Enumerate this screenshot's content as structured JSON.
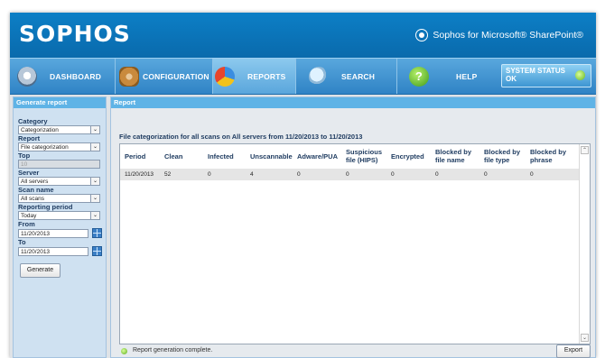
{
  "header": {
    "logo": "SOPHOS",
    "product": "Sophos for Microsoft® SharePoint®"
  },
  "nav": {
    "items": [
      {
        "label": "DASHBOARD",
        "icon": "dashboard-icon"
      },
      {
        "label": "CONFIGURATION",
        "icon": "gear-icon"
      },
      {
        "label": "REPORTS",
        "icon": "pie-chart-icon"
      },
      {
        "label": "SEARCH",
        "icon": "magnifier-icon"
      },
      {
        "label": "HELP",
        "icon": "help-icon"
      }
    ],
    "status_line1": "SYSTEM STATUS",
    "status_line2": "OK"
  },
  "sidebar": {
    "title": "Generate report",
    "category_label": "Category",
    "category_value": "Categorization",
    "report_label": "Report",
    "report_value": "File categorization",
    "top_label": "Top",
    "top_value": "10",
    "server_label": "Server",
    "server_value": "All servers",
    "scan_label": "Scan name",
    "scan_value": "All scans",
    "period_label": "Reporting period",
    "period_value": "Today",
    "from_label": "From",
    "from_value": "11/20/2013",
    "to_label": "To",
    "to_value": "11/20/2013",
    "generate_label": "Generate"
  },
  "report": {
    "panel_title": "Report",
    "heading": "File categorization for all scans on All servers from 11/20/2013 to 11/20/2013",
    "columns": [
      "Period",
      "Clean",
      "Infected",
      "Unscannable",
      "Adware/PUA",
      "Suspicious file (HIPS)",
      "Encrypted",
      "Blocked by file name",
      "Blocked by file type",
      "Blocked by phrase"
    ],
    "rows": [
      [
        "11/20/2013",
        "52",
        "0",
        "4",
        "0",
        "0",
        "0",
        "0",
        "0",
        "0"
      ]
    ],
    "status_text": "Report generation complete.",
    "export_label": "Export"
  },
  "colors": {
    "header": "#0a6aac",
    "nav": "#3c8fd0",
    "status_ok": "#63b51e"
  }
}
